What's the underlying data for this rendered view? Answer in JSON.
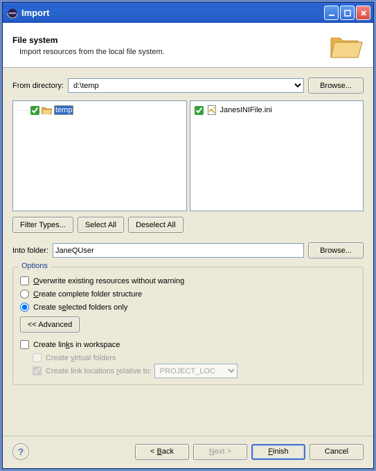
{
  "window": {
    "title": "Import"
  },
  "banner": {
    "heading": "File system",
    "description": "Import resources from the local file system."
  },
  "from": {
    "label": "From directory:",
    "value": "d:\\temp",
    "browse": "Browse..."
  },
  "tree": {
    "items": [
      {
        "checked": true,
        "label": "temp",
        "selected": true
      }
    ]
  },
  "files": {
    "items": [
      {
        "checked": true,
        "label": "JanesINIFile.ini"
      }
    ]
  },
  "selection_buttons": {
    "filter": "Filter Types...",
    "select_all": "Select All",
    "deselect_all": "Deselect All"
  },
  "into": {
    "label": "Into folder:",
    "value": "JaneQUser",
    "browse": "Browse..."
  },
  "options": {
    "legend": "Options",
    "overwrite": "Overwrite existing resources without warning",
    "create_complete": "Create complete folder structure",
    "create_selected": "Create selected folders only",
    "advanced": "<< Advanced",
    "create_links": "Create links in workspace",
    "create_virtual": "Create virtual folders",
    "link_relative": "Create link locations relative to:",
    "link_relative_value": "PROJECT_LOC"
  },
  "footer": {
    "back": "< Back",
    "next": "Next >",
    "finish": "Finish",
    "cancel": "Cancel"
  }
}
